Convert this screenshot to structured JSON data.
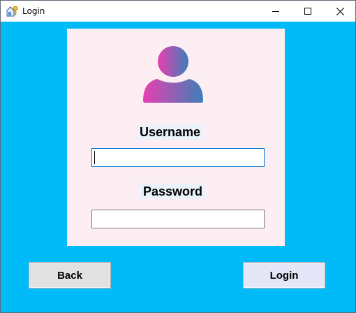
{
  "window": {
    "title": "Login",
    "icon": "lock-key-icon",
    "controls": [
      "minimize-icon",
      "maximize-icon",
      "close-icon"
    ]
  },
  "form": {
    "avatar_icon": "user-avatar-icon",
    "username_label": "Username",
    "username_value": "",
    "password_label": "Password",
    "password_value": ""
  },
  "buttons": {
    "back_label": "Back",
    "login_label": "Login"
  },
  "colors": {
    "window_background": "#00bbf7",
    "panel_background": "#fdeef4",
    "avatar_gradient_start": "#e83fb0",
    "avatar_gradient_end": "#3d7fb8"
  }
}
